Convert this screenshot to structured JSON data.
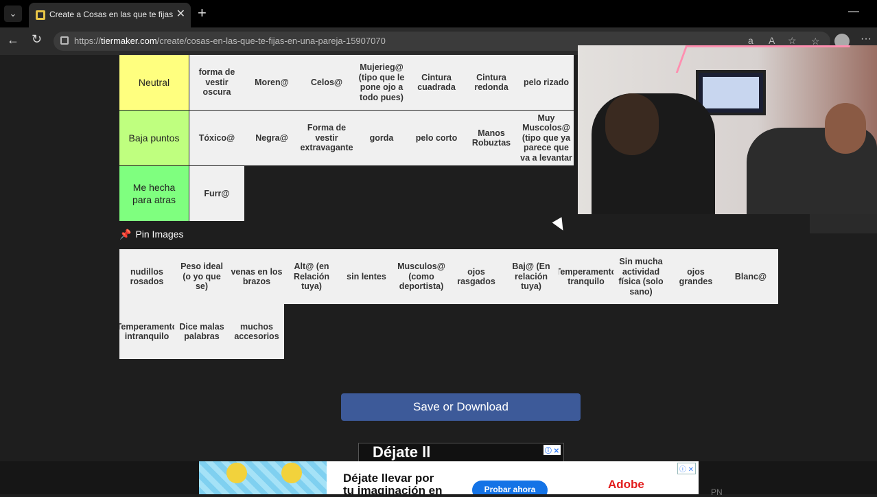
{
  "browser": {
    "tab_title": "Create a Cosas en las que te fijas e",
    "url_prefix": "https://",
    "url_domain": "tiermaker.com",
    "url_path": "/create/cosas-en-las-que-te-fijas-en-una-pareja-15907070",
    "new_tab": "+",
    "tab_close": "✕",
    "minimize": "—",
    "more": "···"
  },
  "tiers": [
    {
      "label": "Neutral",
      "color": "#ffff7f",
      "items": [
        "forma de vestir oscura",
        "Moren@",
        "Celos@",
        "Mujerieg@ (tipo que le pone ojo a todo pues)",
        "Cintura cuadrada",
        "Cintura redonda",
        "pelo rizado"
      ]
    },
    {
      "label": "Baja puntos",
      "color": "#bfff7f",
      "items": [
        "Tóxico@",
        "Negra@",
        "Forma de vestir extravagante",
        "gorda",
        "pelo corto",
        "Manos Robuztas",
        "Muy Muscolos@ (tipo que ya parece que va a levantar"
      ]
    },
    {
      "label": "Me hecha para atras",
      "color": "#7fff7f",
      "items": [
        "Furr@"
      ]
    }
  ],
  "pin_images": "Pin Images",
  "pool": {
    "row1": [
      "nudillos rosados",
      "Peso ideal (o yo que se)",
      "venas en los brazos",
      "Alt@ (en Relación tuya)",
      "sin lentes",
      "Musculos@ (como deportista)",
      "ojos rasgados",
      "Baj@ (En relación tuya)",
      "Temperamento tranquilo",
      "Sin mucha actividad física (solo sano)",
      "ojos grandes",
      "Blanc@"
    ],
    "row2": [
      "Temperamento intranquilo",
      "Dice malas palabras",
      "muchos accesorios"
    ]
  },
  "save_button": "Save or Download",
  "ad_small": {
    "text": "Déjate ll"
  },
  "ad_bottom": {
    "text_line1": "Déjate llevar por",
    "text_line2": "tu imaginación en",
    "button": "Probar ahora",
    "brand": "Adobe",
    "corner": "PN"
  }
}
